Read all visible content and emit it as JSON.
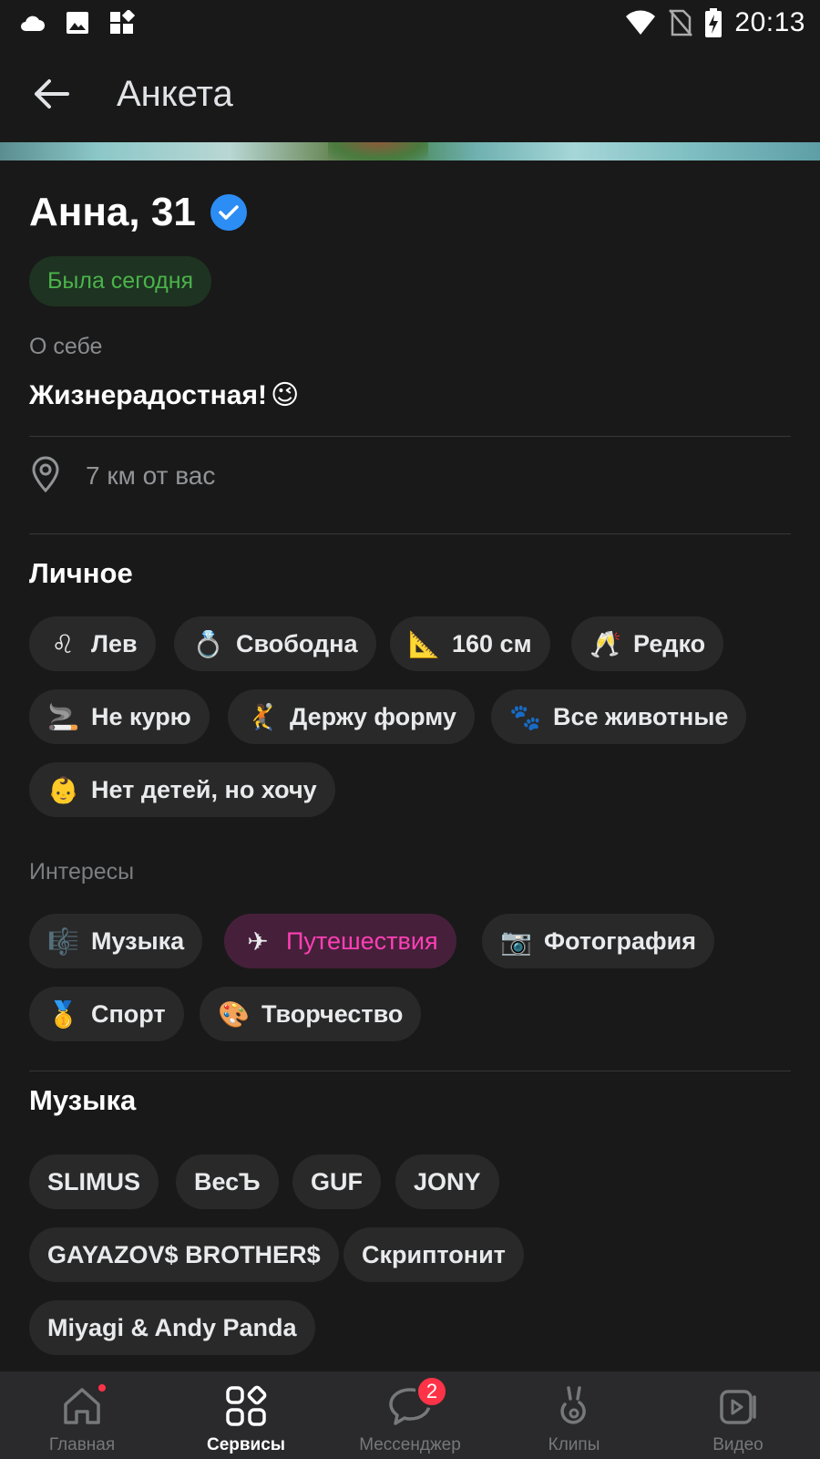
{
  "status_bar": {
    "time": "20:13",
    "left_icons": [
      "cloud-icon",
      "image-icon",
      "widgets-icon"
    ],
    "right_icons": [
      "wifi-icon",
      "no-sim-icon",
      "battery-charging-icon"
    ]
  },
  "app_bar": {
    "title": "Анкета",
    "back_icon": "arrow-left-icon"
  },
  "profile": {
    "name": "Анна, 31",
    "verified": true,
    "online_status": "Была сегодня",
    "about_label": "О себе",
    "about_text": "Жизнерадостная!",
    "about_emoji": "😉",
    "distance": "7 км от вас"
  },
  "personal": {
    "title": "Личное",
    "chips": [
      {
        "emoji": "♌",
        "label": "Лев"
      },
      {
        "emoji": "💍",
        "label": "Свободна"
      },
      {
        "emoji": "📐",
        "label": "160 см"
      },
      {
        "emoji": "🥂",
        "label": "Редко"
      },
      {
        "emoji": "🚬",
        "label": "Не курю"
      },
      {
        "emoji": "🤾",
        "label": "Держу форму"
      },
      {
        "emoji": "🐾",
        "label": "Все животные"
      },
      {
        "emoji": "👶",
        "label": "Нет детей, но хочу"
      }
    ]
  },
  "interests": {
    "label": "Интересы",
    "chips": [
      {
        "emoji": "🎼",
        "label": "Музыка"
      },
      {
        "emoji": "✈",
        "label": "Путешествия",
        "highlighted": true
      },
      {
        "emoji": "📷",
        "label": "Фотография"
      },
      {
        "emoji": "🥇",
        "label": "Спорт"
      },
      {
        "emoji": "🎨",
        "label": "Творчество"
      }
    ]
  },
  "music": {
    "title": "Музыка",
    "artists": [
      "SLIMUS",
      "ВесЪ",
      "GUF",
      "JONY",
      "GAYAZOV$ BROTHER$",
      "Скриптонит",
      "Miyagi & Andy Panda"
    ]
  },
  "bottom_nav": {
    "items": [
      {
        "label": "Главная",
        "icon": "home-icon",
        "dot": true
      },
      {
        "label": "Сервисы",
        "icon": "services-icon",
        "active": true
      },
      {
        "label": "Мессенджер",
        "icon": "messenger-icon",
        "badge": "2"
      },
      {
        "label": "Клипы",
        "icon": "clips-icon"
      },
      {
        "label": "Видео",
        "icon": "video-icon"
      }
    ]
  },
  "colors": {
    "background": "#191919",
    "accent_blue": "#2c8df5",
    "online_green": "#4bb34b",
    "highlight_pink": "#ff3fb6",
    "badge_red": "#ff3347"
  }
}
